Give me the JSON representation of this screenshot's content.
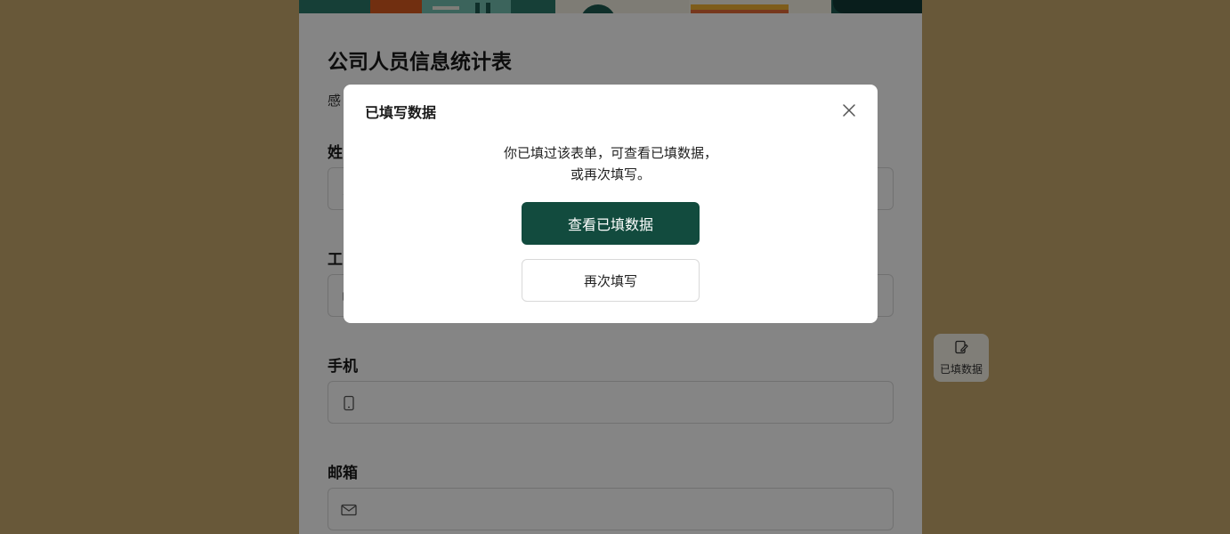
{
  "form": {
    "title": "公司人员信息统计表",
    "description": "感",
    "fields": [
      {
        "label": "姓",
        "icon": "user-icon"
      },
      {
        "label": "工",
        "icon": "id-icon"
      },
      {
        "label": "手机",
        "icon": "phone-icon"
      },
      {
        "label": "邮箱",
        "icon": "mail-icon"
      }
    ]
  },
  "side_button": {
    "label": "已填数据",
    "icon": "edit-note-icon"
  },
  "modal": {
    "title": "已填写数据",
    "message_line1": "你已填过该表单，可查看已填数据，",
    "message_line2": "或再次填写。",
    "view_button": "查看已填数据",
    "refill_button": "再次填写",
    "close_icon": "close-icon"
  },
  "colors": {
    "page_bg": "#c7a96e",
    "primary": "#124b3e",
    "overlay": "rgba(0,0,0,0.48)"
  }
}
